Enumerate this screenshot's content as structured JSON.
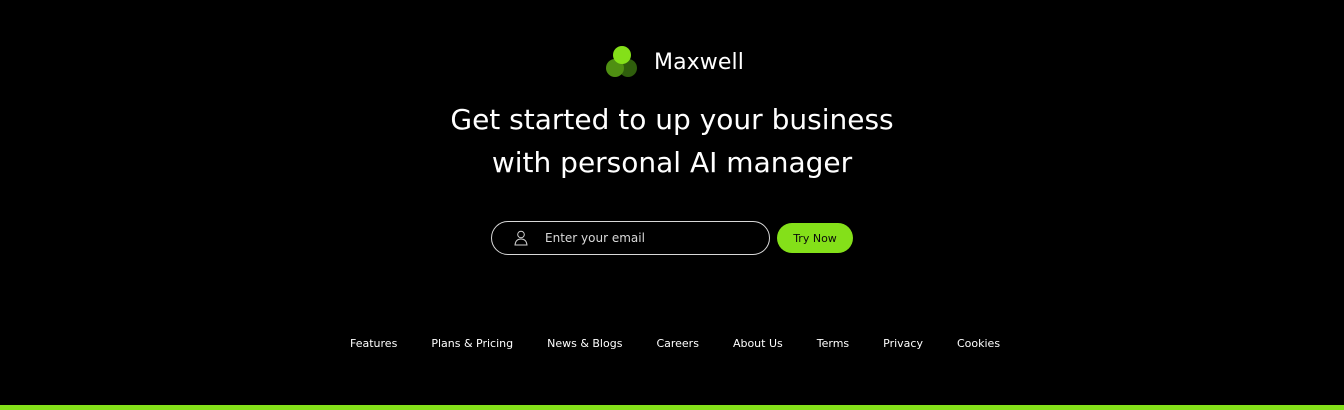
{
  "brand": {
    "name": "Maxwell",
    "logo_icon": "three-circles-logo"
  },
  "hero": {
    "headline_line1": "Get started to up your business",
    "headline_line2": "with personal AI manager"
  },
  "signup": {
    "email_placeholder": "Enter your email",
    "email_icon": "user-icon",
    "cta_label": "Try Now"
  },
  "footer": {
    "links": [
      {
        "label": "Features"
      },
      {
        "label": "Plans & Pricing"
      },
      {
        "label": "News & Blogs"
      },
      {
        "label": "Careers"
      },
      {
        "label": "About Us"
      },
      {
        "label": "Terms"
      },
      {
        "label": "Privacy"
      },
      {
        "label": "Cookies"
      }
    ]
  },
  "colors": {
    "background": "#000000",
    "accent": "#84e019",
    "logo_mid": "#4f8f12",
    "logo_dark": "#2f5e0c",
    "text": "#ffffff"
  }
}
